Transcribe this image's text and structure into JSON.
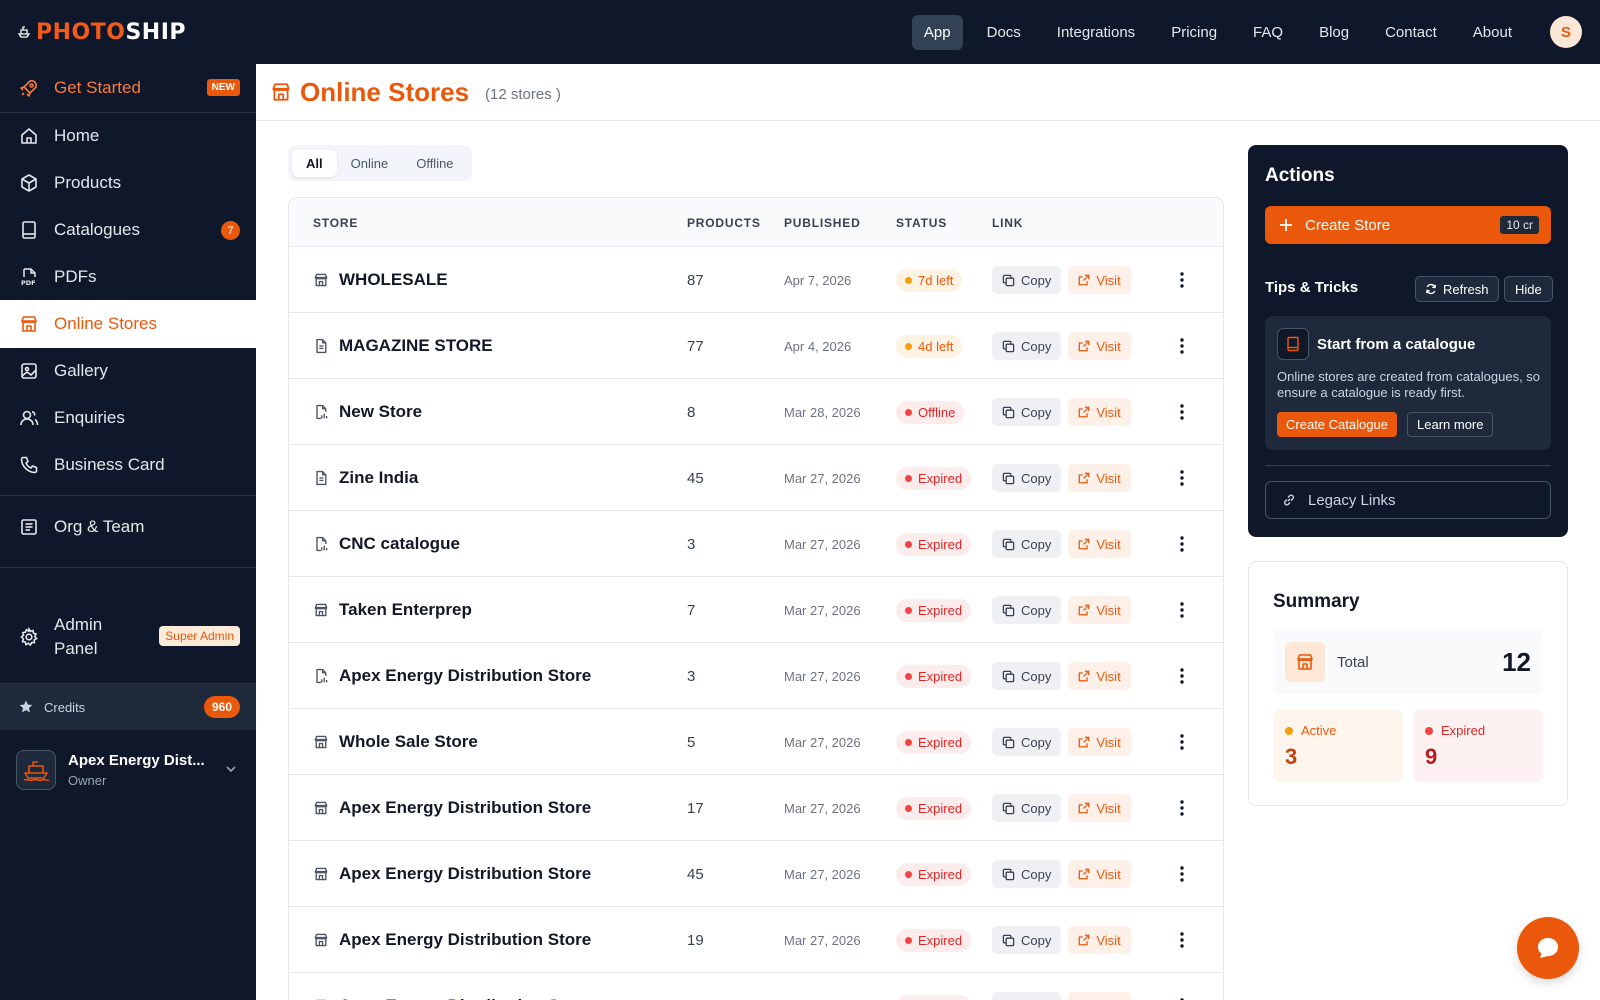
{
  "brand": {
    "name_part1": "PHOTO",
    "name_part2": "SHIP"
  },
  "topnav": {
    "items": [
      {
        "label": "App",
        "active": true
      },
      {
        "label": "Docs"
      },
      {
        "label": "Integrations"
      },
      {
        "label": "Pricing"
      },
      {
        "label": "FAQ"
      },
      {
        "label": "Blog"
      },
      {
        "label": "Contact"
      },
      {
        "label": "About"
      }
    ],
    "avatar_initial": "S"
  },
  "sidebar": {
    "get_started": {
      "label": "Get Started",
      "badge": "NEW"
    },
    "items": [
      {
        "label": "Home",
        "icon": "home-icon"
      },
      {
        "label": "Products",
        "icon": "box-icon"
      },
      {
        "label": "Catalogues",
        "icon": "book-icon",
        "badge": "7"
      },
      {
        "label": "PDFs",
        "icon": "pdf-icon"
      },
      {
        "label": "Online Stores",
        "icon": "store-icon",
        "active": true
      },
      {
        "label": "Gallery",
        "icon": "image-icon"
      },
      {
        "label": "Enquiries",
        "icon": "users-icon"
      },
      {
        "label": "Business Card",
        "icon": "phone-icon"
      }
    ],
    "org_team": {
      "label": "Org & Team"
    },
    "admin": {
      "label": "Admin Panel",
      "badge": "Super Admin"
    },
    "credits": {
      "label": "Credits",
      "value": "960"
    },
    "account": {
      "name": "Apex Energy Dist...",
      "role": "Owner"
    }
  },
  "page": {
    "title": "Online Stores",
    "count_text": "(12 stores )"
  },
  "filters": {
    "tabs": [
      {
        "label": "All",
        "active": true
      },
      {
        "label": "Online"
      },
      {
        "label": "Offline"
      }
    ]
  },
  "table": {
    "columns": {
      "store": "STORE",
      "products": "PRODUCTS",
      "published": "PUBLISHED",
      "status": "STATUS",
      "link": "LINK"
    },
    "copy_label": "Copy",
    "visit_label": "Visit",
    "rows": [
      {
        "name": "WHOLESALE",
        "icon": "store-icon",
        "products": "87",
        "published": "Apr 7, 2026",
        "status": "7d left",
        "status_kind": "warn"
      },
      {
        "name": "MAGAZINE STORE",
        "icon": "document-icon",
        "products": "77",
        "published": "Apr 4, 2026",
        "status": "4d left",
        "status_kind": "warn"
      },
      {
        "name": "New Store",
        "icon": "file-chart-icon",
        "products": "8",
        "published": "Mar 28, 2026",
        "status": "Offline",
        "status_kind": "bad"
      },
      {
        "name": "Zine India",
        "icon": "document-icon",
        "products": "45",
        "published": "Mar 27, 2026",
        "status": "Expired",
        "status_kind": "bad"
      },
      {
        "name": "CNC catalogue",
        "icon": "file-chart-icon",
        "products": "3",
        "published": "Mar 27, 2026",
        "status": "Expired",
        "status_kind": "bad"
      },
      {
        "name": "Taken Enterprep",
        "icon": "store-icon",
        "products": "7",
        "published": "Mar 27, 2026",
        "status": "Expired",
        "status_kind": "bad"
      },
      {
        "name": "Apex Energy Distribution Store",
        "icon": "file-chart-icon",
        "products": "3",
        "published": "Mar 27, 2026",
        "status": "Expired",
        "status_kind": "bad"
      },
      {
        "name": "Whole Sale Store",
        "icon": "store-icon",
        "products": "5",
        "published": "Mar 27, 2026",
        "status": "Expired",
        "status_kind": "bad"
      },
      {
        "name": "Apex Energy Distribution Store",
        "icon": "store-icon",
        "products": "17",
        "published": "Mar 27, 2026",
        "status": "Expired",
        "status_kind": "bad"
      },
      {
        "name": "Apex Energy Distribution Store",
        "icon": "store-icon",
        "products": "45",
        "published": "Mar 27, 2026",
        "status": "Expired",
        "status_kind": "bad"
      },
      {
        "name": "Apex Energy Distribution Store",
        "icon": "store-icon",
        "products": "19",
        "published": "Mar 27, 2026",
        "status": "Expired",
        "status_kind": "bad"
      },
      {
        "name": "Apex Energy Distribution Store",
        "icon": "store-icon",
        "products": "",
        "published": "",
        "status": "Expired",
        "status_kind": "bad"
      }
    ]
  },
  "actions": {
    "title": "Actions",
    "create_store": {
      "label": "Create Store",
      "cost": "10 cr"
    },
    "tips_title": "Tips & Tricks",
    "refresh_label": "Refresh",
    "hide_label": "Hide",
    "tip": {
      "title": "Start from a catalogue",
      "text": "Online stores are created from catalogues, so ensure a catalogue is ready first.",
      "primary": "Create Catalogue",
      "secondary": "Learn more"
    },
    "legacy_label": "Legacy Links"
  },
  "summary": {
    "title": "Summary",
    "total_label": "Total",
    "total_value": "12",
    "active_label": "Active",
    "active_value": "3",
    "expired_label": "Expired",
    "expired_value": "9"
  },
  "colors": {
    "accent": "#ea580c",
    "nav_bg": "#0f172a",
    "warn": "#f59e0b",
    "danger": "#dc2626"
  }
}
